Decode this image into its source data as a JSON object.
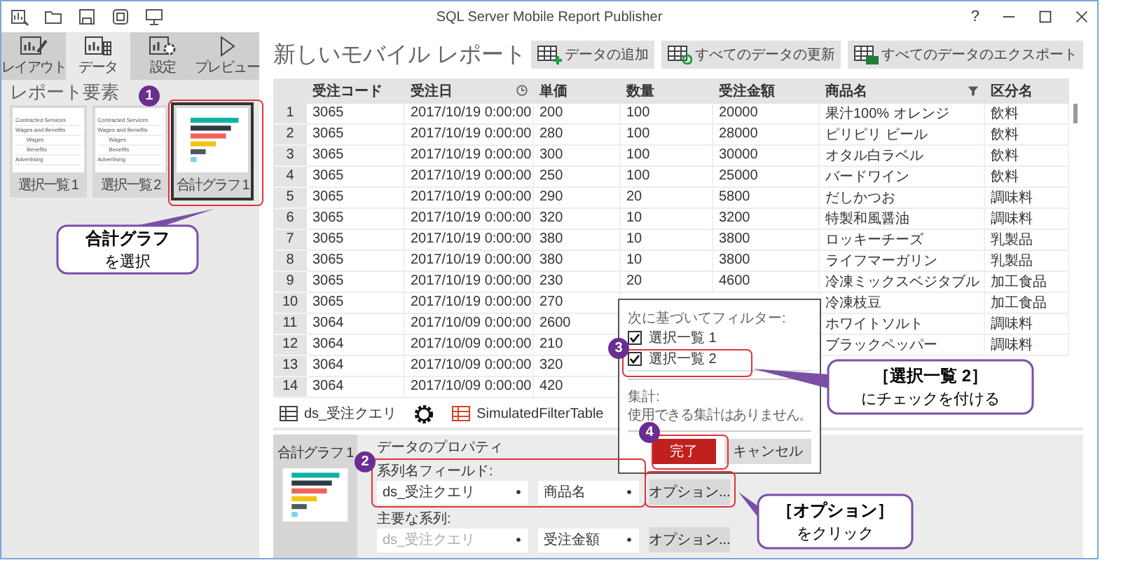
{
  "window": {
    "title": "SQL Server Mobile Report Publisher",
    "help": "?"
  },
  "tabs": [
    {
      "label": "レイアウト",
      "selected": false
    },
    {
      "label": "データ",
      "selected": true
    },
    {
      "label": "設定",
      "selected": false
    },
    {
      "label": "プレビュー",
      "selected": false
    }
  ],
  "sidebar": {
    "heading": "レポート要素",
    "elements": [
      {
        "kind": "list",
        "label": "選択一覧 1",
        "selected": false,
        "items": [
          {
            "label": "Contracted Services"
          },
          {
            "label": "Wages and Benefits",
            "children": [
              {
                "label": "Wages"
              },
              {
                "label": "Benefits"
              }
            ]
          },
          {
            "label": "Advertising"
          }
        ]
      },
      {
        "kind": "list",
        "label": "選択一覧 2",
        "selected": false,
        "items": [
          {
            "label": "Contracted Services"
          },
          {
            "label": "Wages and Benefits",
            "children": [
              {
                "label": "Wages"
              },
              {
                "label": "Benefits"
              }
            ]
          },
          {
            "label": "Advertising"
          }
        ]
      },
      {
        "kind": "chart",
        "label": "合計グラフ 1",
        "selected": true
      }
    ]
  },
  "report": {
    "title": "新しいモバイル レポート",
    "actions": [
      {
        "label": "データの追加"
      },
      {
        "label": "すべてのデータの更新"
      },
      {
        "label": "すべてのデータのエクスポート"
      }
    ]
  },
  "table": {
    "columns": [
      {
        "label": "受注コード"
      },
      {
        "label": "受注日"
      },
      {
        "label": "単価"
      },
      {
        "label": "数量"
      },
      {
        "label": "受注金額"
      },
      {
        "label": "商品名"
      },
      {
        "label": "区分名"
      }
    ],
    "rows": [
      {
        "num": "1",
        "code": "3065",
        "date": "2017/10/19 0:00:00",
        "price": "200",
        "qty": "100",
        "amount": "20000",
        "product": "果汁100% オレンジ",
        "category": "飲料"
      },
      {
        "num": "2",
        "code": "3065",
        "date": "2017/10/19 0:00:00",
        "price": "280",
        "qty": "100",
        "amount": "28000",
        "product": "ピリピリ ビール",
        "category": "飲料"
      },
      {
        "num": "3",
        "code": "3065",
        "date": "2017/10/19 0:00:00",
        "price": "300",
        "qty": "100",
        "amount": "30000",
        "product": "オタル白ラベル",
        "category": "飲料"
      },
      {
        "num": "4",
        "code": "3065",
        "date": "2017/10/19 0:00:00",
        "price": "250",
        "qty": "100",
        "amount": "25000",
        "product": "バードワイン",
        "category": "飲料"
      },
      {
        "num": "5",
        "code": "3065",
        "date": "2017/10/19 0:00:00",
        "price": "290",
        "qty": "20",
        "amount": "5800",
        "product": "だしかつお",
        "category": "調味料"
      },
      {
        "num": "6",
        "code": "3065",
        "date": "2017/10/19 0:00:00",
        "price": "320",
        "qty": "10",
        "amount": "3200",
        "product": "特製和風醤油",
        "category": "調味料"
      },
      {
        "num": "7",
        "code": "3065",
        "date": "2017/10/19 0:00:00",
        "price": "380",
        "qty": "10",
        "amount": "3800",
        "product": "ロッキーチーズ",
        "category": "乳製品"
      },
      {
        "num": "8",
        "code": "3065",
        "date": "2017/10/19 0:00:00",
        "price": "380",
        "qty": "10",
        "amount": "3800",
        "product": "ライフマーガリン",
        "category": "乳製品"
      },
      {
        "num": "9",
        "code": "3065",
        "date": "2017/10/19 0:00:00",
        "price": "230",
        "qty": "20",
        "amount": "4600",
        "product": "冷凍ミックスベジタブル",
        "category": "加工食品"
      },
      {
        "num": "10",
        "code": "3065",
        "date": "2017/10/19 0:00:00",
        "price": "270",
        "product": "冷凍枝豆",
        "category": "加工食品"
      },
      {
        "num": "11",
        "code": "3064",
        "date": "2017/10/09 0:00:00",
        "price": "2600",
        "product": "ホワイトソルト",
        "category": "調味料"
      },
      {
        "num": "12",
        "code": "3064",
        "date": "2017/10/09 0:00:00",
        "price": "210",
        "product": "ブラックペッパー",
        "category": "調味料"
      },
      {
        "num": "13",
        "code": "3064",
        "date": "2017/10/09 0:00:00",
        "price": "320"
      },
      {
        "num": "14",
        "code": "3064",
        "date": "2017/10/09 0:00:00",
        "price": "420"
      }
    ]
  },
  "datasets": [
    {
      "kind": "table",
      "label": "ds_受注クエリ"
    },
    {
      "kind": "settings"
    },
    {
      "kind": "simulated",
      "label": "SimulatedFilterTable"
    }
  ],
  "properties": {
    "element": "合計グラフ 1",
    "heading": "データのプロパティ",
    "fields": [
      {
        "label": "系列名フィールド:",
        "source": {
          "value": "ds_受注クエリ",
          "disabled": false
        },
        "field": {
          "value": "商品名",
          "disabled": false
        },
        "button": "オプション..."
      },
      {
        "label": "主要な系列:",
        "source": {
          "value": "ds_受注クエリ",
          "disabled": true
        },
        "field": {
          "value": "受注金額",
          "disabled": false
        },
        "button": "オプション..."
      }
    ]
  },
  "filter_popup": {
    "heading": "次に基づいてフィルター:",
    "options": [
      {
        "label": "選択一覧 1",
        "checked": true
      },
      {
        "label": "選択一覧 2",
        "checked": true
      }
    ],
    "aggregate_label": "集計:",
    "aggregate_note": "使用できる集計はありません。",
    "buttons": [
      {
        "label": "完了",
        "kind": "primary"
      },
      {
        "label": "キャンセル",
        "kind": "secondary"
      }
    ]
  },
  "annotations": {
    "steps": [
      "1",
      "2",
      "3",
      "4"
    ],
    "callouts": [
      {
        "title": "合計グラフ",
        "note": "を選択"
      },
      {
        "title": "［選択一覧 2］",
        "note": "にチェックを付ける"
      },
      {
        "title": "［オプション］",
        "note": "をクリック"
      }
    ]
  }
}
